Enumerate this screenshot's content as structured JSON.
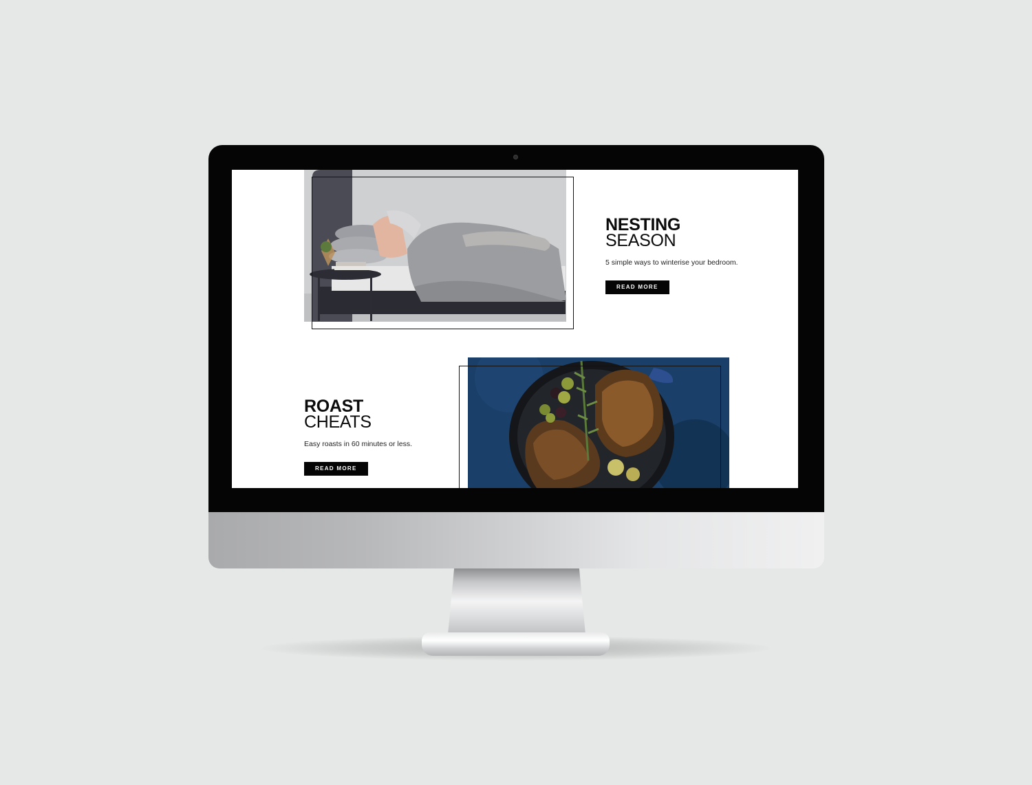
{
  "features": [
    {
      "title_bold": "NESTING",
      "title_light": "SEASON",
      "subtitle": "5 simple ways to winterise your bedroom.",
      "button_label": "READ MORE"
    },
    {
      "title_bold": "ROAST",
      "title_light": "CHEATS",
      "subtitle": "Easy roasts in 60 minutes or less.",
      "button_label": "READ MORE"
    }
  ],
  "colors": {
    "background": "#e6e8e7",
    "bezel": "#050505",
    "button": "#050505",
    "text": "#0b0b0b"
  }
}
